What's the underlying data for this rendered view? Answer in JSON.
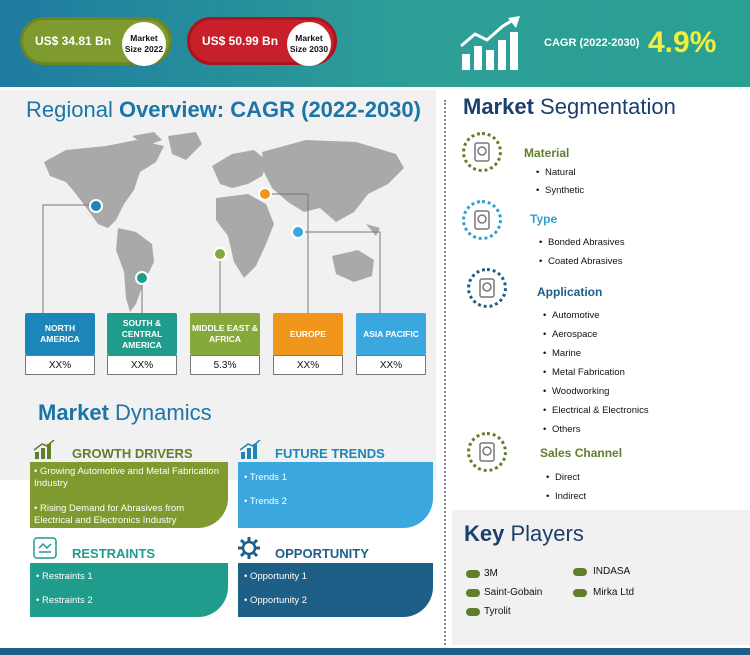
{
  "header": {
    "market_2022_value": "US$ 34.81 Bn",
    "market_2022_label": "Market Size 2022",
    "market_2030_value": "US$ 50.99 Bn",
    "market_2030_label": "Market Size 2030",
    "cagr_label": "CAGR (2022-2030)",
    "cagr_value": "4.9%"
  },
  "regional": {
    "title_prefix": "Regional ",
    "title_bold": "Overview: CAGR (2022-2030)",
    "regions": [
      {
        "name": "NORTH AMERICA",
        "value": "XX%",
        "color": "#1c86b8"
      },
      {
        "name": "SOUTH & CENTRAL AMERICA",
        "value": "XX%",
        "color": "#1f9c8c"
      },
      {
        "name": "MIDDLE EAST & AFRICA",
        "value": "5.3%",
        "color": "#87a83a"
      },
      {
        "name": "EUROPE",
        "value": "XX%",
        "color": "#f0961d"
      },
      {
        "name": "ASIA PACIFIC",
        "value": "XX%",
        "color": "#3aa7de"
      }
    ]
  },
  "dynamics": {
    "title_bold": "Market ",
    "title_rest": "Dynamics",
    "growth_drivers": {
      "title": "GROWTH DRIVERS",
      "items": [
        "Growing Automotive and Metal Fabrication Industry",
        "Rising Demand for Abrasives from Electrical and Electronics Industry"
      ]
    },
    "future_trends": {
      "title": "FUTURE TRENDS",
      "items": [
        "Trends 1",
        "Trends 2"
      ]
    },
    "restraints": {
      "title": "RESTRAINTS",
      "items": [
        "Restraints 1",
        "Restraints 2"
      ]
    },
    "opportunity": {
      "title": "OPPORTUNITY",
      "items": [
        "Opportunity 1",
        "Opportunity 2"
      ]
    }
  },
  "segmentation": {
    "title_bold": "Market ",
    "title_rest": "Segmentation",
    "groups": [
      {
        "name": "Material",
        "items": [
          "Natural",
          "Synthetic"
        ],
        "color": "#5f7f2b"
      },
      {
        "name": "Type",
        "items": [
          "Bonded Abrasives",
          "Coated Abrasives"
        ],
        "color": "#2f9fd3"
      },
      {
        "name": "Application",
        "items": [
          "Automotive",
          "Aerospace",
          "Marine",
          "Metal Fabrication",
          "Woodworking",
          "Electrical & Electronics",
          "Others"
        ],
        "color": "#1d5f86"
      },
      {
        "name": "Sales Channel",
        "items": [
          "Direct",
          "Indirect"
        ],
        "color": "#5f7f2b"
      }
    ]
  },
  "key_players": {
    "title_bold": "Key ",
    "title_rest": "Players",
    "left": [
      "3M",
      "Saint-Gobain",
      "Tyrolit"
    ],
    "right": [
      "INDASA",
      "Mirka Ltd"
    ]
  }
}
